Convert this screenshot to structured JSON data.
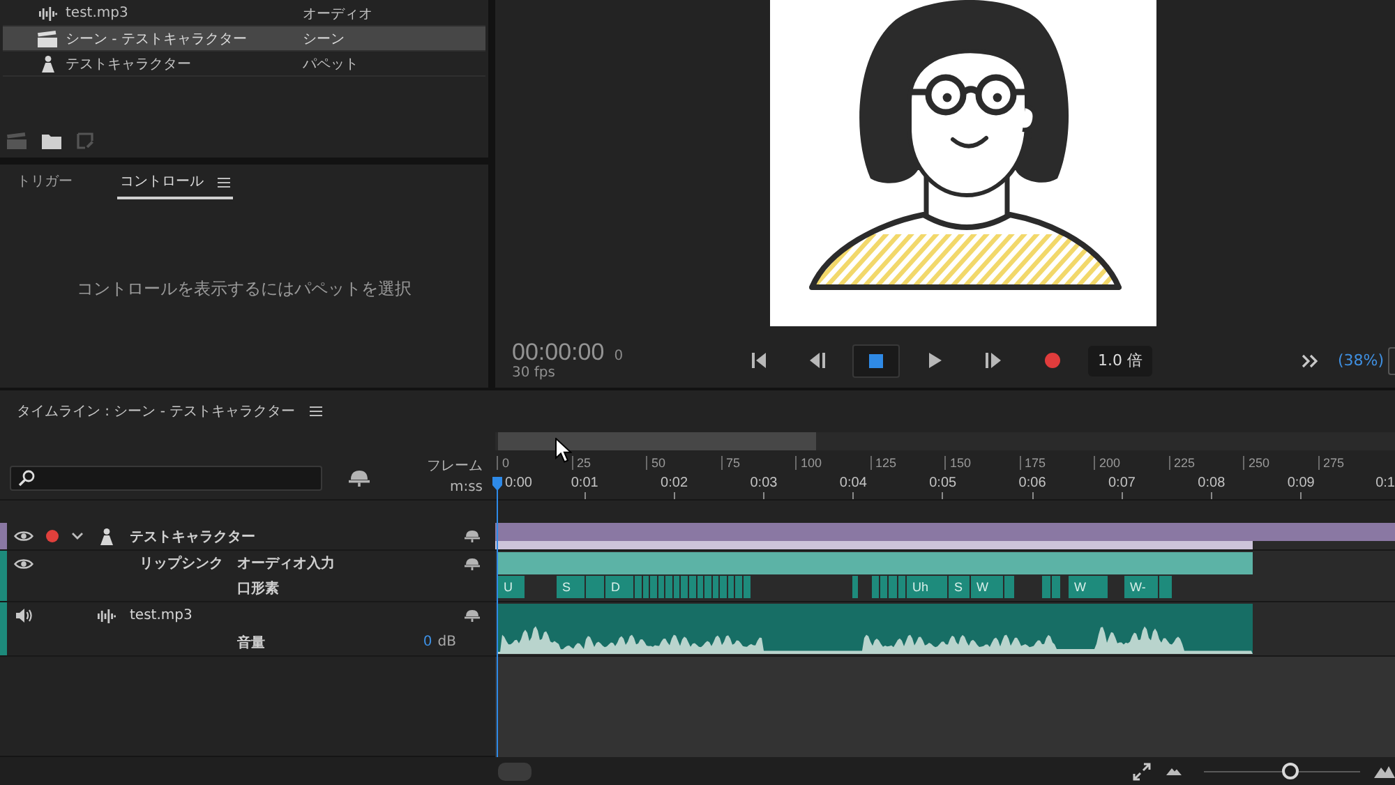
{
  "project": {
    "items": [
      {
        "kind": "audio",
        "name": "test.mp3",
        "type": "オーディオ",
        "selected": false
      },
      {
        "kind": "scene",
        "name": "シーン - テストキャラクター",
        "type": "シーン",
        "selected": true
      },
      {
        "kind": "puppet",
        "name": "テストキャラクター",
        "type": "パペット",
        "selected": false
      }
    ],
    "toolbar": [
      {
        "kind": "scene",
        "disabled": true
      },
      {
        "kind": "folder",
        "disabled": false
      },
      {
        "kind": "item",
        "disabled": true
      }
    ]
  },
  "properties": {
    "tabs": [
      {
        "label": "トリガー",
        "selected": false
      },
      {
        "label": "コントロール",
        "selected": true
      }
    ],
    "message": "コントロールを表示するにはパペットを選択"
  },
  "transport": {
    "timecode": "00:00:00",
    "frame": "0",
    "fps": "30 fps",
    "speed": "1.0 倍",
    "zoom": "(38%)"
  },
  "timeline": {
    "title": "タイムライン : シーン - テストキャラクター",
    "ruler": {
      "frame_label": "フレーム",
      "time_label": "m:ss",
      "frames": [
        "0",
        "25",
        "50",
        "75",
        "100",
        "125",
        "150",
        "175",
        "200",
        "225",
        "250",
        "275"
      ],
      "times": [
        "0:00",
        "0:01",
        "0:02",
        "0:03",
        "0:04",
        "0:05",
        "0:06",
        "0:07",
        "0:08",
        "0:09",
        "0:1"
      ]
    },
    "tracks": [
      {
        "kind": "puppet",
        "name": "テストキャラクター",
        "color": "#8a78a3",
        "visible": true,
        "armed": true,
        "expanded": true
      },
      {
        "kind": "lipsync",
        "name": "リップシンク",
        "color": "#1d8a7b",
        "visible": true,
        "input": "オーディオ入力",
        "visemes_label": "口形素",
        "visemes": [
          {
            "label": "U"
          },
          {
            "label": "S"
          },
          {
            "label": "D"
          },
          {
            "label": "Uh"
          },
          {
            "label": "S"
          },
          {
            "label": "W"
          },
          {
            "label": "W"
          },
          {
            "label": "W-"
          }
        ]
      },
      {
        "kind": "audio",
        "name": "test.mp3",
        "color": "#1d8a7b",
        "muted": false,
        "volume_label": "音量",
        "volume": "0",
        "volume_unit": "dB"
      }
    ],
    "zoom": {
      "level": 0.55
    }
  }
}
